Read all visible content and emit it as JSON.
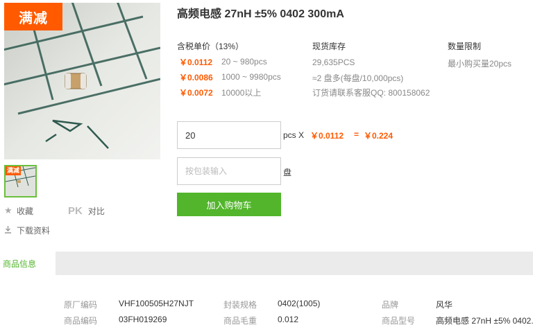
{
  "product": {
    "title": "高频电感 27nH ±5% 0402 300mA",
    "promo_badge": "满减",
    "thumb_badge": "满减"
  },
  "actions": {
    "favorite": "收藏",
    "pk": "PK",
    "compare": "对比",
    "download": "下载资料"
  },
  "pricing": {
    "header": "含税单价（13%）",
    "tiers": [
      {
        "price": "￥0.0112",
        "range": "20 ~ 980pcs"
      },
      {
        "price": "￥0.0086",
        "range": "1000 ~ 9980pcs"
      },
      {
        "price": "￥0.0072",
        "range": "10000以上"
      }
    ]
  },
  "stock": {
    "header": "现货库存",
    "quantity": "29,635PCS",
    "reels": "≈2 盘多(每盘/10,000pcs)",
    "contact": "订货请联系客服QQ: 800158062"
  },
  "limit": {
    "header": "数量限制",
    "min": "最小购买量20pcs"
  },
  "order": {
    "qty_value": "20",
    "pcs_x": "pcs X",
    "unit_price": "￥0.0112",
    "equals": "=",
    "total": "￥0.224",
    "pack_placeholder": "按包装输入",
    "pack_unit": "盘",
    "add_to_cart": "加入购物车"
  },
  "tabs": {
    "active": "商品信息"
  },
  "specs": [
    {
      "label": "原厂编码",
      "value": "VHF100505H27NJT"
    },
    {
      "label": "封装规格",
      "value": "0402(1005)"
    },
    {
      "label": "品牌",
      "value": "风华"
    },
    {
      "label": "商品编码",
      "value": "03FH019269"
    },
    {
      "label": "商品毛重",
      "value": "0.012"
    },
    {
      "label": "商品型号",
      "value": "高频电感 27nH ±5% 0402..."
    }
  ],
  "colors": {
    "accent": "#ff5a00",
    "green": "#52b52b"
  },
  "icons": {
    "favorite": "star-icon",
    "download": "download-icon"
  }
}
